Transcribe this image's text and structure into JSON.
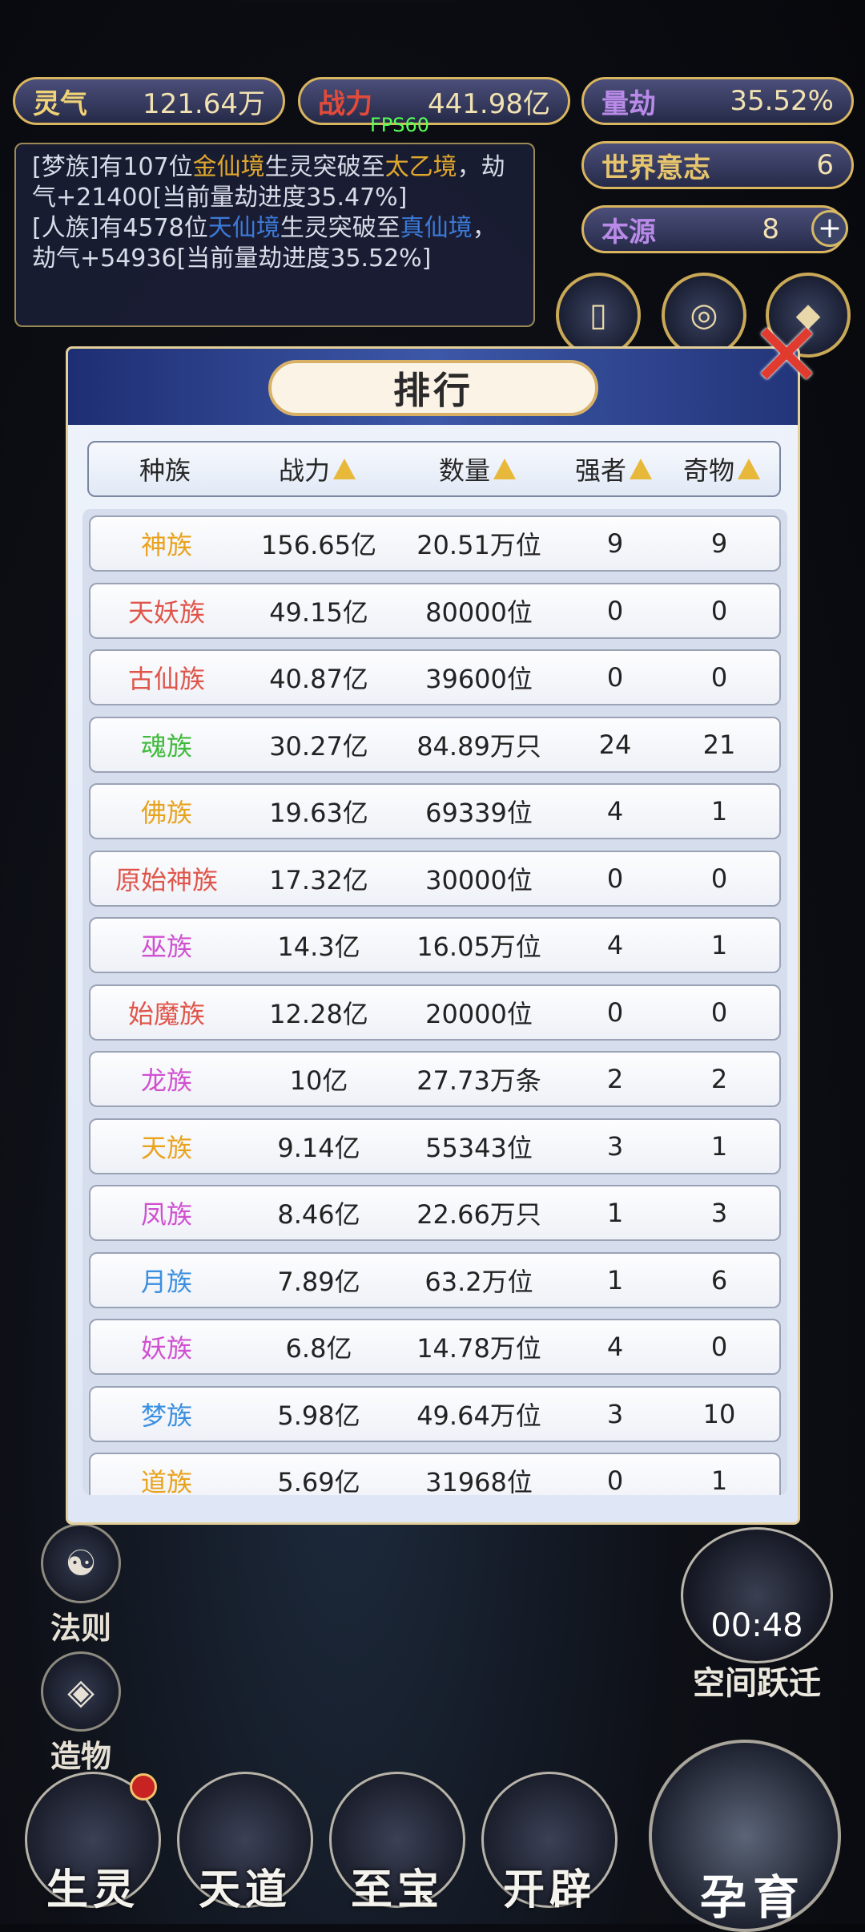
{
  "top_stats": {
    "lingqi": {
      "label": "灵气",
      "value": "121.64万"
    },
    "zhanli": {
      "label": "战力",
      "value": "441.98亿"
    },
    "liangjie": {
      "label": "量劫",
      "value": "35.52%"
    },
    "world_will": {
      "label": "世界意志",
      "value": "6"
    },
    "origin": {
      "label": "本源",
      "value": "8"
    }
  },
  "fps": "FPS60",
  "log": {
    "line1_a": "[梦族]有107位",
    "line1_b": "金仙境",
    "line1_c": "生灵突破至",
    "line1_d": "太乙境",
    "line1_e": "，劫气+21400[当前量劫进度35.47%]",
    "line2_a": "[人族]有4578位",
    "line2_b": "天仙境",
    "line2_c": "生灵突破至",
    "line2_d": "真仙境",
    "line2_e": "，劫气+54936[当前量劫进度35.52%]"
  },
  "dialog": {
    "title": "排行",
    "headers": {
      "race": "种族",
      "power": "战力",
      "count": "数量",
      "strong": "强者",
      "item": "奇物"
    },
    "rows": [
      {
        "race": "神族",
        "color": "#e9a21b",
        "power": "156.65亿",
        "count": "20.51万位",
        "strong": "9",
        "item": "9"
      },
      {
        "race": "天妖族",
        "color": "#e0554a",
        "power": "49.15亿",
        "count": "80000位",
        "strong": "0",
        "item": "0"
      },
      {
        "race": "古仙族",
        "color": "#e0554a",
        "power": "40.87亿",
        "count": "39600位",
        "strong": "0",
        "item": "0"
      },
      {
        "race": "魂族",
        "color": "#3fba3b",
        "power": "30.27亿",
        "count": "84.89万只",
        "strong": "24",
        "item": "21"
      },
      {
        "race": "佛族",
        "color": "#e9a21b",
        "power": "19.63亿",
        "count": "69339位",
        "strong": "4",
        "item": "1"
      },
      {
        "race": "原始神族",
        "color": "#e0554a",
        "power": "17.32亿",
        "count": "30000位",
        "strong": "0",
        "item": "0"
      },
      {
        "race": "巫族",
        "color": "#d050d0",
        "power": "14.3亿",
        "count": "16.05万位",
        "strong": "4",
        "item": "1"
      },
      {
        "race": "始魔族",
        "color": "#e0554a",
        "power": "12.28亿",
        "count": "20000位",
        "strong": "0",
        "item": "0"
      },
      {
        "race": "龙族",
        "color": "#d050d0",
        "power": "10亿",
        "count": "27.73万条",
        "strong": "2",
        "item": "2"
      },
      {
        "race": "天族",
        "color": "#e9a21b",
        "power": "9.14亿",
        "count": "55343位",
        "strong": "3",
        "item": "1"
      },
      {
        "race": "凤族",
        "color": "#d050d0",
        "power": "8.46亿",
        "count": "22.66万只",
        "strong": "1",
        "item": "3"
      },
      {
        "race": "月族",
        "color": "#3b8fe0",
        "power": "7.89亿",
        "count": "63.2万位",
        "strong": "1",
        "item": "6"
      },
      {
        "race": "妖族",
        "color": "#d050d0",
        "power": "6.8亿",
        "count": "14.78万位",
        "strong": "4",
        "item": "0"
      },
      {
        "race": "梦族",
        "color": "#3b8fe0",
        "power": "5.98亿",
        "count": "49.64万位",
        "strong": "3",
        "item": "10"
      },
      {
        "race": "道族",
        "color": "#e9a21b",
        "power": "5.69亿",
        "count": "31968位",
        "strong": "0",
        "item": "1"
      }
    ]
  },
  "side_menu": {
    "fa_ze": "法则",
    "zao_wu": "造物"
  },
  "space_jump": {
    "timer": "00:48",
    "label": "空间跃迁"
  },
  "bottom_nav": {
    "sheng_ling": "生灵",
    "tian_dao": "天道",
    "zhi_bao": "至宝",
    "kai_pi": "开辟",
    "yun_yu": "孕育"
  }
}
